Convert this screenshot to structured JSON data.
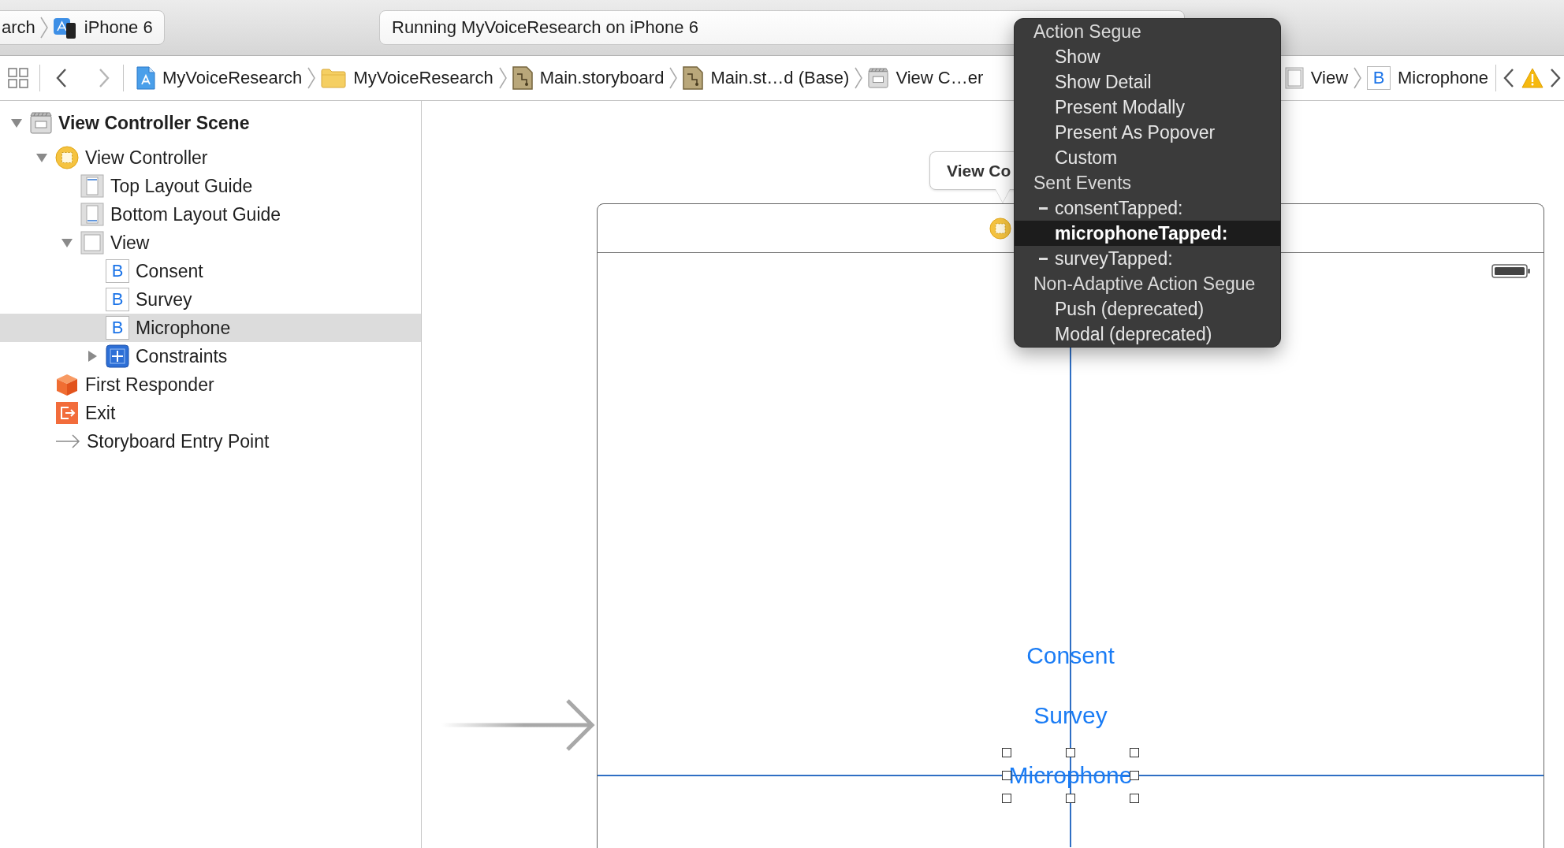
{
  "toolbar": {
    "scheme": {
      "project": "arch",
      "device": "iPhone 6"
    },
    "activity": {
      "status": "Running MyVoiceResearch on iPhone 6"
    }
  },
  "jump_bar": {
    "history": [
      {
        "kind": "back",
        "disabled": false
      },
      {
        "kind": "forward",
        "disabled": true
      }
    ],
    "path": [
      {
        "kind": "app",
        "label": "MyVoiceResearch"
      },
      {
        "kind": "folder",
        "label": "MyVoiceResearch"
      },
      {
        "kind": "storyboard",
        "label": "Main.storyboard"
      },
      {
        "kind": "storyboard",
        "label": "Main.st…d (Base)"
      },
      {
        "kind": "scene",
        "label": "View C…er"
      },
      {
        "kind": "view",
        "label": "View"
      },
      {
        "kind": "button",
        "badge": "B",
        "label": "Microphone"
      }
    ]
  },
  "outline": {
    "items": [
      {
        "kind": "scene",
        "label": "View Controller Scene",
        "expanded": true,
        "selected": false,
        "children": [
          {
            "kind": "view-controller",
            "label": "View Controller",
            "expanded": true,
            "selected": false,
            "children": [
              {
                "kind": "top-guide",
                "label": "Top Layout Guide",
                "selected": false
              },
              {
                "kind": "bottom-guide",
                "label": "Bottom Layout Guide",
                "selected": false
              },
              {
                "kind": "view",
                "label": "View",
                "expanded": true,
                "selected": false,
                "children": [
                  {
                    "kind": "button",
                    "badge": "B",
                    "label": "Consent",
                    "selected": false
                  },
                  {
                    "kind": "button",
                    "badge": "B",
                    "label": "Survey",
                    "selected": false
                  },
                  {
                    "kind": "button",
                    "badge": "B",
                    "label": "Microphone",
                    "selected": true
                  },
                  {
                    "kind": "constraints",
                    "label": "Constraints",
                    "expanded": false,
                    "selected": false
                  }
                ]
              }
            ]
          },
          {
            "kind": "first-responder",
            "label": "First Responder",
            "selected": false
          },
          {
            "kind": "exit",
            "label": "Exit",
            "selected": false
          },
          {
            "kind": "entry-point",
            "label": "Storyboard Entry Point",
            "selected": false
          }
        ]
      }
    ]
  },
  "canvas": {
    "scene_title": "View Co",
    "buttons": [
      {
        "label": "Consent",
        "selected": false
      },
      {
        "label": "Survey",
        "selected": false
      },
      {
        "label": "Microphone",
        "selected": true
      }
    ]
  },
  "menu": {
    "sections": [
      {
        "title": "Action Segue",
        "items": [
          {
            "label": "Show",
            "connected": false,
            "selected": false
          },
          {
            "label": "Show Detail",
            "connected": false,
            "selected": false
          },
          {
            "label": "Present Modally",
            "connected": false,
            "selected": false
          },
          {
            "label": "Present As Popover",
            "connected": false,
            "selected": false
          },
          {
            "label": "Custom",
            "connected": false,
            "selected": false
          }
        ]
      },
      {
        "title": "Sent Events",
        "items": [
          {
            "label": "consentTapped:",
            "connected": true,
            "selected": false
          },
          {
            "label": "microphoneTapped:",
            "connected": false,
            "selected": true
          },
          {
            "label": "surveyTapped:",
            "connected": true,
            "selected": false
          }
        ]
      },
      {
        "title": "Non-Adaptive Action Segue",
        "items": [
          {
            "label": "Push (deprecated)",
            "connected": false,
            "selected": false
          },
          {
            "label": "Modal (deprecated)",
            "connected": false,
            "selected": false
          }
        ]
      }
    ]
  }
}
